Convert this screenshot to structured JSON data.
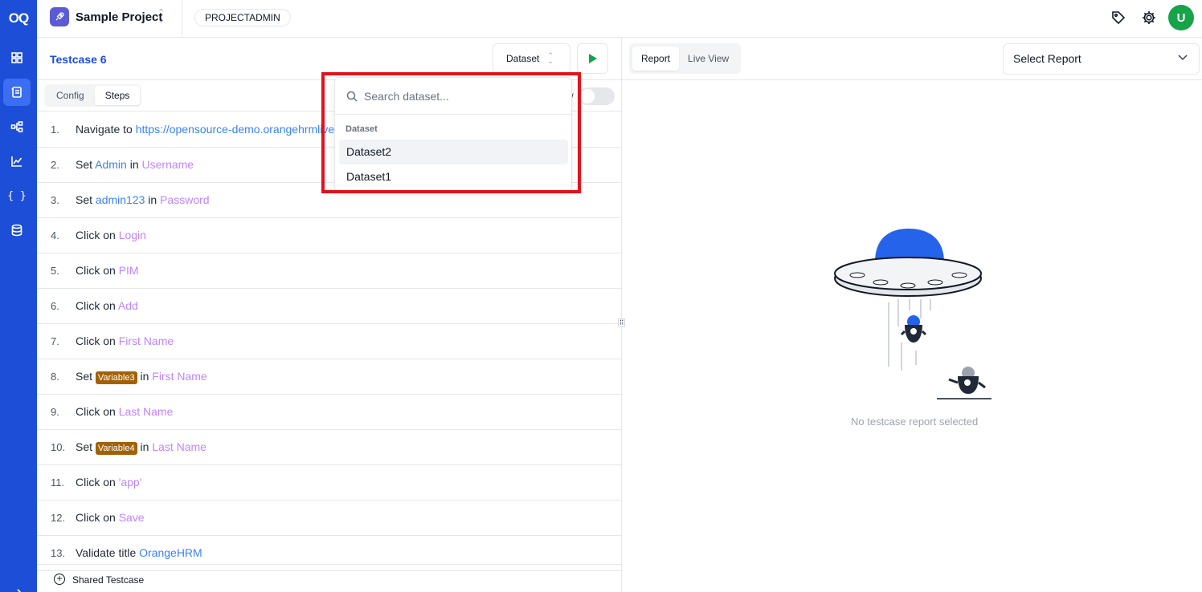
{
  "app": {
    "logo_text": "OQ"
  },
  "rail": {
    "items": [
      "dashboard-icon",
      "testcases-icon",
      "flow-icon",
      "analytics-icon",
      "variables-icon",
      "database-icon"
    ]
  },
  "header": {
    "project_name": "Sample Project",
    "role": "PROJECTADMIN",
    "avatar_initial": "U"
  },
  "testcase": {
    "title": "Testcase 6",
    "dataset_button": "Dataset",
    "tabs": [
      "Config",
      "Steps"
    ],
    "active_tab": "Steps",
    "toggle_label_fragment": "w"
  },
  "dataset_dropdown": {
    "search_placeholder": "Search dataset...",
    "group_label": "Dataset",
    "options": [
      "Dataset2",
      "Dataset1"
    ],
    "highlighted": "Dataset2"
  },
  "steps": [
    {
      "n": "1.",
      "action": "Navigate to",
      "target": "https://opensource-demo.orangehrmlive.com"
    },
    {
      "n": "2.",
      "action": "Set",
      "value": "Admin",
      "in": "in",
      "target": "Username"
    },
    {
      "n": "3.",
      "action": "Set",
      "value": "admin123",
      "in": "in",
      "target": "Password"
    },
    {
      "n": "4.",
      "action": "Click on",
      "target": "Login"
    },
    {
      "n": "5.",
      "action": "Click on",
      "target": "PIM"
    },
    {
      "n": "6.",
      "action": "Click on",
      "target": "Add"
    },
    {
      "n": "7.",
      "action": "Click on",
      "target": "First Name"
    },
    {
      "n": "8.",
      "action": "Set",
      "variable": "Variable3",
      "in": "in",
      "target": "First Name"
    },
    {
      "n": "9.",
      "action": "Click on",
      "target": "Last Name"
    },
    {
      "n": "10.",
      "action": "Set",
      "variable": "Variable4",
      "in": "in",
      "target": "Last Name"
    },
    {
      "n": "11.",
      "action": "Click on",
      "target": "'app'"
    },
    {
      "n": "12.",
      "action": "Click on",
      "target": "Save"
    },
    {
      "n": "13.",
      "action": "Validate title",
      "target": "OrangeHRM"
    }
  ],
  "shared_testcase": {
    "label": "Shared Testcase"
  },
  "report_panel": {
    "tabs": [
      "Report",
      "Live View"
    ],
    "active_tab": "Report",
    "select_placeholder": "Select Report",
    "empty_message": "No testcase report selected"
  },
  "colors": {
    "brand": "#1d4ed8",
    "link": "#3b82f6",
    "element": "#c084fc",
    "variable_badge": "#a16207",
    "run": "#16a34a",
    "highlight": "#e1121b"
  }
}
